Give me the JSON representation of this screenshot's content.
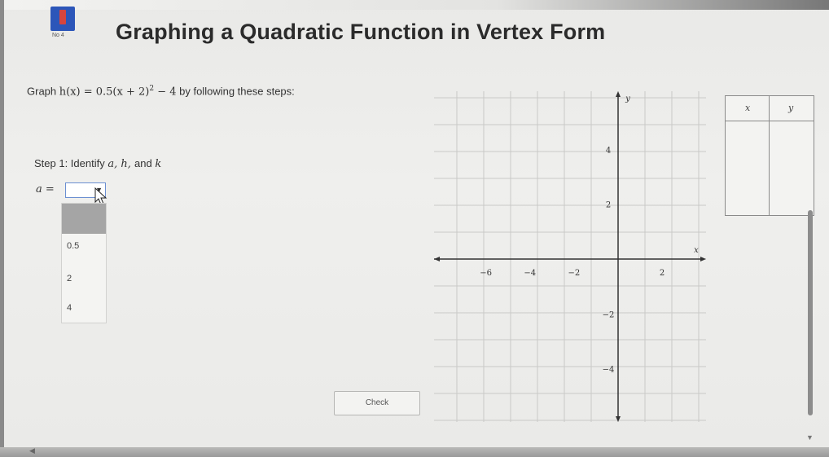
{
  "header": {
    "title": "Graphing a Quadratic Function in Vertex Form",
    "logo_caption": "No 4"
  },
  "instructions": {
    "prefix": "Graph ",
    "function": "h(x) = 0.5(x + 2)",
    "exponent": "2",
    "suffix_math": " − 4",
    "suffix": " by following these steps:"
  },
  "step": {
    "text": "Step 1: Identify ",
    "vars": "a, h, ",
    "and": "and ",
    "last": "k"
  },
  "a_field": {
    "label": "a =",
    "selected_value": "",
    "options": [
      "0.5",
      "2",
      "4"
    ]
  },
  "check_button": {
    "label": "Check"
  },
  "graph": {
    "x_axis_label": "x",
    "y_axis_label": "y",
    "x_ticks": [
      "−6",
      "−4",
      "−2",
      "2"
    ],
    "y_ticks": [
      "4",
      "2",
      "−2",
      "−4"
    ]
  },
  "table": {
    "col_x": "x",
    "col_y": "y"
  },
  "icons": {
    "logo": "app-logo-icon",
    "dropdown_arrow": "chevron-down-icon",
    "cursor": "mouse-pointer-icon"
  },
  "colors": {
    "logo_blue": "#2c56b9",
    "logo_red": "#d6453f",
    "select_border": "#6b8fd1"
  }
}
